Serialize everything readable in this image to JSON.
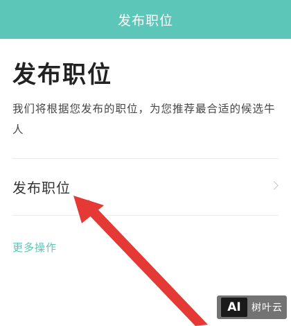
{
  "header": {
    "title": "发布职位"
  },
  "main": {
    "heading": "发布职位",
    "description": "我们将根据您发布的职位，为您推荐最合适的候选牛人",
    "post_job_row": {
      "label": "发布职位",
      "icon": "chevron-right-icon"
    },
    "more_actions": "更多操作"
  },
  "watermark": {
    "logo": "AI",
    "text": "树叶云"
  },
  "colors": {
    "accent": "#5cc6b8",
    "arrow": "#e53935"
  }
}
